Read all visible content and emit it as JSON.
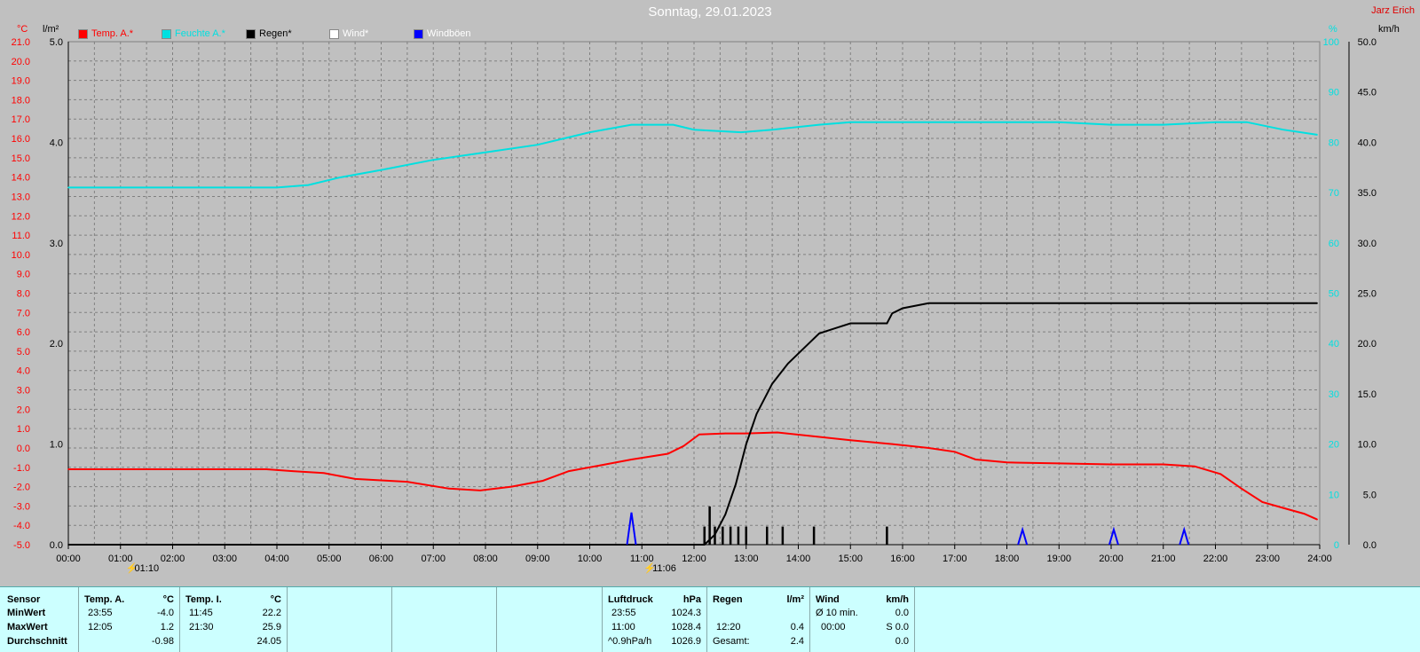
{
  "title": "Sonntag, 29.01.2023",
  "author": "Jarz Erich",
  "legend": [
    {
      "label": "Temp. A.*",
      "color": "#ff0000",
      "text_color": "#ff0000"
    },
    {
      "label": "Feuchte A.*",
      "color": "#00e0e0",
      "text_color": "#00e0e0"
    },
    {
      "label": "Regen*",
      "color": "#000000",
      "text_color": "#000000"
    },
    {
      "label": "Wind*",
      "color": "#ffffff",
      "text_color": "#ffffff"
    },
    {
      "label": "Windböen",
      "color": "#0000ff",
      "text_color": "#ffffff"
    }
  ],
  "units": {
    "temp": "°C",
    "rain": "l/m²",
    "humidity": "%",
    "wind": "km/h"
  },
  "markers": [
    {
      "time": "01:10",
      "hour": 1.1667
    },
    {
      "time": "11:06",
      "hour": 11.1
    }
  ],
  "chart_data": {
    "type": "line",
    "title": "Sonntag, 29.01.2023",
    "x_ticks": [
      "00:00",
      "01:00",
      "02:00",
      "03:00",
      "04:00",
      "05:00",
      "06:00",
      "07:00",
      "08:00",
      "09:00",
      "10:00",
      "11:00",
      "12:00",
      "13:00",
      "14:00",
      "15:00",
      "16:00",
      "17:00",
      "18:00",
      "19:00",
      "20:00",
      "21:00",
      "22:00",
      "23:00",
      "24:00"
    ],
    "xlim": [
      0,
      24
    ],
    "axes": {
      "temp": {
        "label": "°C",
        "ylim": [
          -5,
          21
        ],
        "ticks": [
          "21.0",
          "20.0",
          "19.0",
          "18.0",
          "17.0",
          "16.0",
          "15.0",
          "14.0",
          "13.0",
          "12.0",
          "11.0",
          "10.0",
          "9.0",
          "8.0",
          "7.0",
          "6.0",
          "5.0",
          "4.0",
          "3.0",
          "2.0",
          "1.0",
          "0.0",
          "-1.0",
          "-2.0",
          "-3.0",
          "-4.0",
          "-5.0"
        ]
      },
      "rain": {
        "label": "l/m²",
        "ylim": [
          0,
          5
        ],
        "ticks": [
          "5.0",
          "4.0",
          "3.0",
          "2.0",
          "1.0",
          "0.0"
        ]
      },
      "humidity": {
        "label": "%",
        "ylim": [
          0,
          100
        ],
        "ticks": [
          "100",
          "90",
          "80",
          "70",
          "60",
          "50",
          "40",
          "30",
          "20",
          "10",
          "0"
        ]
      },
      "wind": {
        "label": "km/h",
        "ylim": [
          0,
          50
        ],
        "ticks": [
          "50.0",
          "45.0",
          "40.0",
          "35.0",
          "30.0",
          "25.0",
          "20.0",
          "15.0",
          "10.0",
          "5.0",
          "0.0"
        ]
      }
    },
    "series": [
      {
        "name": "Temp. A.*",
        "axis": "temp",
        "color": "#ff0000",
        "points": [
          [
            0,
            -1.1
          ],
          [
            1,
            -1.1
          ],
          [
            2,
            -1.1
          ],
          [
            3,
            -1.1
          ],
          [
            3.8,
            -1.1
          ],
          [
            4.3,
            -1.2
          ],
          [
            4.9,
            -1.3
          ],
          [
            5.5,
            -1.6
          ],
          [
            6.5,
            -1.75
          ],
          [
            7.3,
            -2.1
          ],
          [
            7.9,
            -2.2
          ],
          [
            8.5,
            -2.0
          ],
          [
            9.1,
            -1.7
          ],
          [
            9.6,
            -1.2
          ],
          [
            10.2,
            -0.9
          ],
          [
            10.8,
            -0.6
          ],
          [
            11.5,
            -0.3
          ],
          [
            11.8,
            0.1
          ],
          [
            12.1,
            0.7
          ],
          [
            12.6,
            0.75
          ],
          [
            13.0,
            0.75
          ],
          [
            13.6,
            0.8
          ],
          [
            14.3,
            0.6
          ],
          [
            15.0,
            0.4
          ],
          [
            15.8,
            0.2
          ],
          [
            16.5,
            0.0
          ],
          [
            17.0,
            -0.2
          ],
          [
            17.4,
            -0.6
          ],
          [
            18.0,
            -0.75
          ],
          [
            19.0,
            -0.8
          ],
          [
            20.0,
            -0.85
          ],
          [
            21.0,
            -0.85
          ],
          [
            21.6,
            -0.95
          ],
          [
            22.1,
            -1.35
          ],
          [
            22.5,
            -2.1
          ],
          [
            22.9,
            -2.8
          ],
          [
            23.3,
            -3.1
          ],
          [
            23.7,
            -3.4
          ],
          [
            23.95,
            -3.7
          ]
        ]
      },
      {
        "name": "Feuchte A.*",
        "axis": "humidity",
        "color": "#00e0e0",
        "points": [
          [
            0,
            71
          ],
          [
            1,
            71
          ],
          [
            2,
            71
          ],
          [
            3,
            71
          ],
          [
            4,
            71
          ],
          [
            4.6,
            71.5
          ],
          [
            5.2,
            73
          ],
          [
            6,
            74.5
          ],
          [
            7,
            76.5
          ],
          [
            8,
            78
          ],
          [
            9,
            79.5
          ],
          [
            10,
            82
          ],
          [
            10.8,
            83.5
          ],
          [
            11.6,
            83.5
          ],
          [
            12,
            82.5
          ],
          [
            12.9,
            82
          ],
          [
            13.5,
            82.5
          ],
          [
            14.4,
            83.5
          ],
          [
            15,
            84
          ],
          [
            16,
            84
          ],
          [
            17,
            84
          ],
          [
            18,
            84
          ],
          [
            19,
            84
          ],
          [
            20,
            83.5
          ],
          [
            21,
            83.5
          ],
          [
            22,
            84
          ],
          [
            22.6,
            84
          ],
          [
            23.3,
            82.5
          ],
          [
            23.95,
            81.5
          ]
        ]
      },
      {
        "name": "Regen*",
        "axis": "rain",
        "color": "#000000",
        "points": [
          [
            0,
            0
          ],
          [
            12.2,
            0
          ],
          [
            12.4,
            0.1
          ],
          [
            12.6,
            0.3
          ],
          [
            12.8,
            0.6
          ],
          [
            13.0,
            1.0
          ],
          [
            13.2,
            1.3
          ],
          [
            13.5,
            1.6
          ],
          [
            13.8,
            1.8
          ],
          [
            14.2,
            2.0
          ],
          [
            14.4,
            2.1
          ],
          [
            14.7,
            2.15
          ],
          [
            15.0,
            2.2
          ],
          [
            15.4,
            2.2
          ],
          [
            15.7,
            2.2
          ],
          [
            15.8,
            2.3
          ],
          [
            16.0,
            2.35
          ],
          [
            16.5,
            2.4
          ],
          [
            17,
            2.4
          ],
          [
            20,
            2.4
          ],
          [
            23.95,
            2.4
          ]
        ]
      },
      {
        "name": "Windböen",
        "axis": "wind",
        "color": "#0000ff",
        "spikes": [
          [
            10.8,
            3.2
          ],
          [
            18.3,
            1.5
          ],
          [
            20.05,
            1.5
          ],
          [
            21.4,
            1.5
          ]
        ]
      }
    ],
    "rain_bars": {
      "axis": "wind",
      "color": "#000000",
      "bars": [
        [
          12.2,
          1.8
        ],
        [
          12.3,
          3.8
        ],
        [
          12.4,
          1.8
        ],
        [
          12.55,
          1.8
        ],
        [
          12.7,
          1.8
        ],
        [
          12.85,
          1.8
        ],
        [
          13.0,
          1.8
        ],
        [
          13.4,
          1.8
        ],
        [
          13.7,
          1.8
        ],
        [
          14.3,
          1.8
        ],
        [
          15.7,
          1.8
        ]
      ]
    }
  },
  "table": {
    "sensor": {
      "header": "Sensor",
      "min": "MinWert",
      "max": "MaxWert",
      "avg": "Durchschnitt"
    },
    "temp_a": {
      "header": "Temp. A.",
      "unit": "°C",
      "min_time": "23:55",
      "min_val": "-4.0",
      "max_time": "12:05",
      "max_val": "1.2",
      "avg": "-0.98"
    },
    "temp_i": {
      "header": "Temp. I.",
      "unit": "°C",
      "min_time": "11:45",
      "min_val": "22.2",
      "max_time": "21:30",
      "max_val": "25.9",
      "avg": "24.05"
    },
    "pressure": {
      "header": "Luftdruck",
      "unit": "hPa",
      "min_time": "23:55",
      "min_val": "1024.3",
      "max_time": "11:00",
      "max_val": "1028.4",
      "trend": "^0.9hPa/h",
      "avg": "1026.9"
    },
    "rain": {
      "header": "Regen",
      "unit": "l/m²",
      "max_time": "12:20",
      "max_val": "0.4",
      "total_label": "Gesamt:",
      "total": "2.4"
    },
    "wind": {
      "header": "Wind",
      "unit": "km/h",
      "avg_label": "Ø 10 min.",
      "avg_val": "0.0",
      "max_time": "00:00",
      "max_val": "S 0.0",
      "avg": "0.0"
    }
  }
}
